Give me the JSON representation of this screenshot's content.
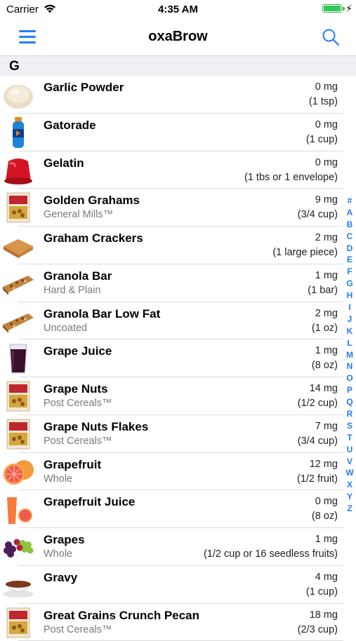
{
  "status": {
    "carrier": "Carrier",
    "time": "4:35 AM"
  },
  "nav": {
    "title": "oxaBrow"
  },
  "section": {
    "letter": "G"
  },
  "items": [
    {
      "name": "Garlic Powder",
      "sub": "",
      "amount": "0 mg",
      "serving": "(1 tsp)",
      "icon": "garlic-powder-image"
    },
    {
      "name": "Gatorade",
      "sub": "",
      "amount": "0 mg",
      "serving": "(1 cup)",
      "icon": "gatorade-bottle-image"
    },
    {
      "name": "Gelatin",
      "sub": "",
      "amount": "0 mg",
      "serving": "(1 tbs or 1 envelope)",
      "icon": "gelatin-image"
    },
    {
      "name": "Golden Grahams",
      "sub": "General Mills™",
      "amount": "9 mg",
      "serving": "(3/4 cup)",
      "icon": "cereal-box-image"
    },
    {
      "name": "Graham Crackers",
      "sub": "",
      "amount": "2 mg",
      "serving": "(1 large piece)",
      "icon": "graham-cracker-image"
    },
    {
      "name": "Granola Bar",
      "sub": "Hard & Plain",
      "amount": "1 mg",
      "serving": "(1 bar)",
      "icon": "granola-bar-image"
    },
    {
      "name": "Granola Bar Low Fat",
      "sub": "Uncoated",
      "amount": "2 mg",
      "serving": "(1 oz)",
      "icon": "granola-bar-image"
    },
    {
      "name": "Grape Juice",
      "sub": "",
      "amount": "1 mg",
      "serving": "(8 oz)",
      "icon": "grape-juice-glass-image"
    },
    {
      "name": "Grape Nuts",
      "sub": "Post Cereals™",
      "amount": "14 mg",
      "serving": "(1/2 cup)",
      "icon": "cereal-box-image"
    },
    {
      "name": "Grape Nuts Flakes",
      "sub": "Post Cereals™",
      "amount": "7 mg",
      "serving": "(3/4 cup)",
      "icon": "cereal-box-image"
    },
    {
      "name": "Grapefruit",
      "sub": "Whole",
      "amount": "12 mg",
      "serving": "(1/2 fruit)",
      "icon": "grapefruit-image"
    },
    {
      "name": "Grapefruit Juice",
      "sub": "",
      "amount": "0 mg",
      "serving": "(8 oz)",
      "icon": "grapefruit-juice-image"
    },
    {
      "name": "Grapes",
      "sub": "Whole",
      "amount": "1 mg",
      "serving": "(1/2 cup or 16 seedless fruits)",
      "icon": "grapes-image"
    },
    {
      "name": "Gravy",
      "sub": "",
      "amount": "4 mg",
      "serving": "(1 cup)",
      "icon": "gravy-boat-image"
    },
    {
      "name": "Great Grains Crunch Pecan",
      "sub": "Post Cereals™",
      "amount": "18 mg",
      "serving": "(2/3 cup)",
      "icon": "cereal-box-image"
    }
  ],
  "index_letters": [
    "#",
    "A",
    "B",
    "C",
    "D",
    "E",
    "F",
    "G",
    "H",
    "I",
    "J",
    "K",
    "L",
    "M",
    "N",
    "O",
    "P",
    "Q",
    "R",
    "S",
    "T",
    "U",
    "V",
    "W",
    "X",
    "Y",
    "Z"
  ],
  "colors": {
    "accent": "#1f7ff2",
    "section_bg": "#efeff4",
    "battery": "#34c759"
  }
}
